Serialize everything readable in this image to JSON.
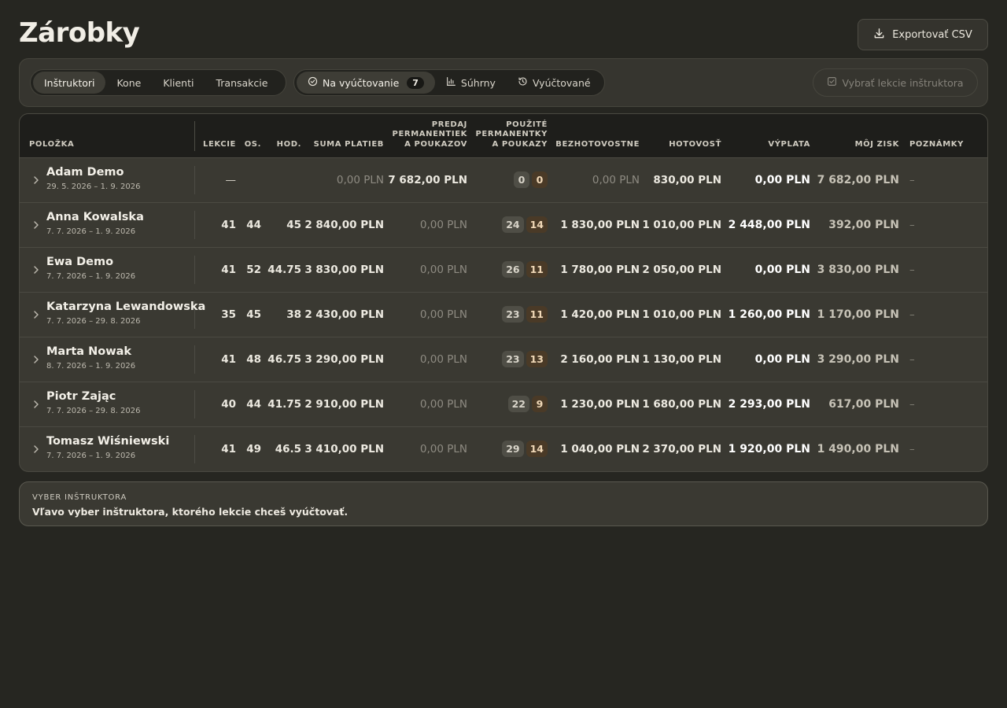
{
  "page": {
    "title": "Zárobky",
    "export_label": "Exportovať CSV"
  },
  "toolbar": {
    "tabs": [
      "Inštruktori",
      "Kone",
      "Klienti",
      "Transakcie"
    ],
    "views": [
      {
        "label": "Na vyúčtovanie",
        "badge": "7",
        "icon": "check-circle-icon"
      },
      {
        "label": "Súhrny",
        "icon": "bar-chart-icon"
      },
      {
        "label": "Vyúčtované",
        "icon": "history-icon"
      }
    ],
    "select_label": "Vybrať lekcie inštruktora"
  },
  "table": {
    "headers": {
      "item": "Položka",
      "lessons": "Lekcie",
      "persons": "Os.",
      "hours": "Hod.",
      "payments": "Suma platieb",
      "sales_line1": "Predaj",
      "sales_line2": "permanentiek",
      "sales_line3": "a poukazov",
      "used_line1": "Použité",
      "used_line2": "permanentky",
      "used_line3": "a poukazy",
      "cashless": "Bezhotovostne",
      "cash": "Hotovosť",
      "payout": "Výplata",
      "profit": "Môj zisk",
      "notes": "Poznámky"
    },
    "rows": [
      {
        "name": "Adam Demo",
        "dates": "29. 5. 2026 – 1. 9. 2026",
        "lessons": "—",
        "persons": "",
        "hours": "",
        "payments": "0,00 PLN",
        "sales": "7 682,00 PLN",
        "used_a": "0",
        "used_b": "0",
        "cashless": "0,00 PLN",
        "cash": "830,00 PLN",
        "payout": "0,00 PLN",
        "profit": "7 682,00 PLN",
        "notes": "–"
      },
      {
        "name": "Anna Kowalska",
        "dates": "7. 7. 2026 – 1. 9. 2026",
        "lessons": "41",
        "persons": "44",
        "hours": "45",
        "payments": "2 840,00 PLN",
        "sales": "0,00 PLN",
        "used_a": "24",
        "used_b": "14",
        "cashless": "1 830,00 PLN",
        "cash": "1 010,00 PLN",
        "payout": "2 448,00 PLN",
        "profit": "392,00 PLN",
        "notes": "–"
      },
      {
        "name": "Ewa Demo",
        "dates": "7. 7. 2026 – 1. 9. 2026",
        "lessons": "41",
        "persons": "52",
        "hours": "44.75",
        "payments": "3 830,00 PLN",
        "sales": "0,00 PLN",
        "used_a": "26",
        "used_b": "11",
        "cashless": "1 780,00 PLN",
        "cash": "2 050,00 PLN",
        "payout": "0,00 PLN",
        "profit": "3 830,00 PLN",
        "notes": "–"
      },
      {
        "name": "Katarzyna Lewandowska",
        "dates": "7. 7. 2026 – 29. 8. 2026",
        "lessons": "35",
        "persons": "45",
        "hours": "38",
        "payments": "2 430,00 PLN",
        "sales": "0,00 PLN",
        "used_a": "23",
        "used_b": "11",
        "cashless": "1 420,00 PLN",
        "cash": "1 010,00 PLN",
        "payout": "1 260,00 PLN",
        "profit": "1 170,00 PLN",
        "notes": "–"
      },
      {
        "name": "Marta Nowak",
        "dates": "8. 7. 2026 – 1. 9. 2026",
        "lessons": "41",
        "persons": "48",
        "hours": "46.75",
        "payments": "3 290,00 PLN",
        "sales": "0,00 PLN",
        "used_a": "23",
        "used_b": "13",
        "cashless": "2 160,00 PLN",
        "cash": "1 130,00 PLN",
        "payout": "0,00 PLN",
        "profit": "3 290,00 PLN",
        "notes": "–"
      },
      {
        "name": "Piotr Zając",
        "dates": "7. 7. 2026 – 29. 8. 2026",
        "lessons": "40",
        "persons": "44",
        "hours": "41.75",
        "payments": "2 910,00 PLN",
        "sales": "0,00 PLN",
        "used_a": "22",
        "used_b": "9",
        "cashless": "1 230,00 PLN",
        "cash": "1 680,00 PLN",
        "payout": "2 293,00 PLN",
        "profit": "617,00 PLN",
        "notes": "–"
      },
      {
        "name": "Tomasz Wiśniewski",
        "dates": "7. 7. 2026 – 1. 9. 2026",
        "lessons": "41",
        "persons": "49",
        "hours": "46.5",
        "payments": "3 410,00 PLN",
        "sales": "0,00 PLN",
        "used_a": "29",
        "used_b": "14",
        "cashless": "1 040,00 PLN",
        "cash": "2 370,00 PLN",
        "payout": "1 920,00 PLN",
        "profit": "1 490,00 PLN",
        "notes": "–"
      }
    ]
  },
  "info": {
    "label": "Vyber inštruktora",
    "text": "Vľavo vyber inštruktora, ktorého lekcie chceš vyúčtovať."
  }
}
